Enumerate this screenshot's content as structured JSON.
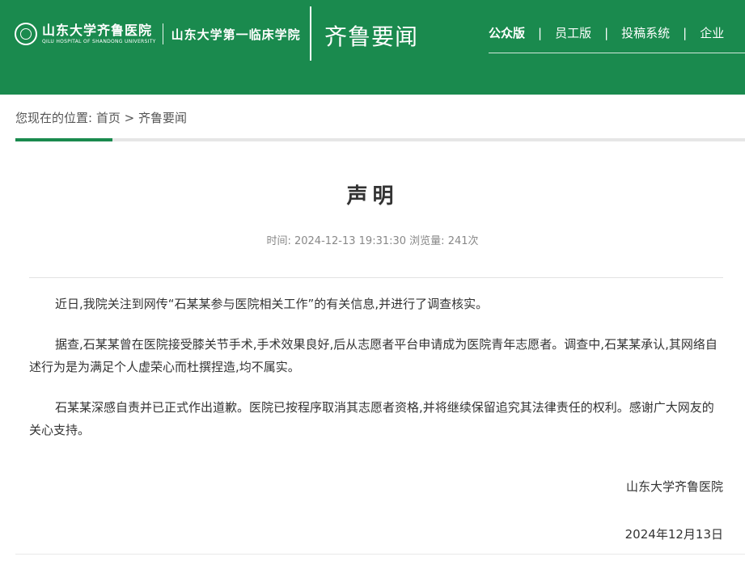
{
  "header": {
    "logo_name": "山东大学齐鲁医院",
    "logo_en": "QILU HOSPITAL OF SHANDONG UNIVERSITY",
    "logo_sub": "山东大学第一临床学院",
    "section_title": "齐鲁要闻",
    "nav": [
      "公众版",
      "员工版",
      "投稿系统",
      "企业"
    ],
    "nav_separator": "|"
  },
  "breadcrumb": {
    "prefix": "您现在的位置:",
    "home": "首页",
    "separator": ">",
    "current": "齐鲁要闻"
  },
  "article": {
    "title": "声明",
    "meta": "时间: 2024-12-13 19:31:30 浏览量: 241次",
    "paragraphs": [
      "近日,我院关注到网传“石某某参与医院相关工作”的有关信息,并进行了调查核实。",
      "据查,石某某曾在医院接受膝关节手术,手术效果良好,后从志愿者平台申请成为医院青年志愿者。调查中,石某某承认,其网络自述行为是为满足个人虚荣心而杜撰捏造,均不属实。",
      "石某某深感自责并已正式作出道歉。医院已按程序取消其志愿者资格,并将继续保留追究其法律责任的权利。感谢广大网友的关心支持。"
    ],
    "signature": "山东大学齐鲁医院",
    "date": "2024年12月13日"
  },
  "colors": {
    "brand_green": "#1a8a4e"
  }
}
